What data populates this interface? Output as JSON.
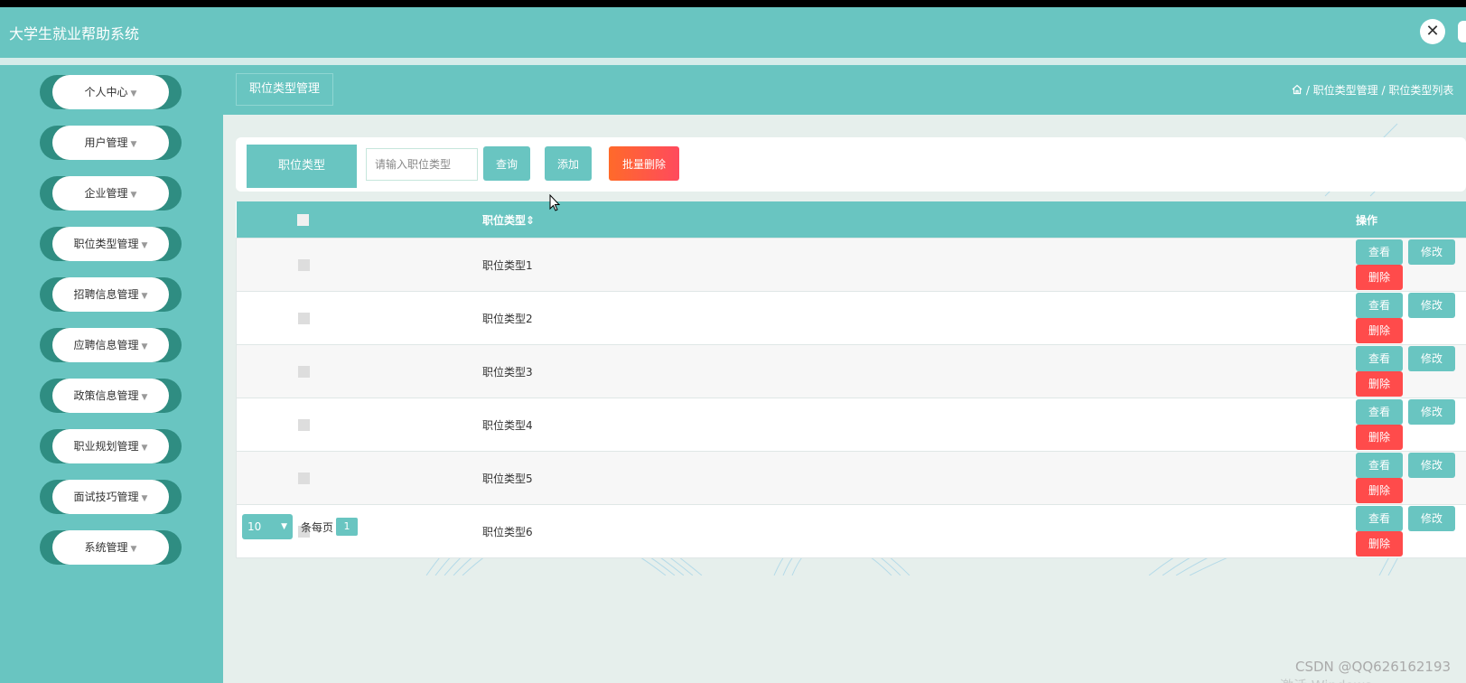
{
  "header": {
    "title": "大学生就业帮助系统"
  },
  "sidebar": {
    "items": [
      {
        "label": "个人中心"
      },
      {
        "label": "用户管理"
      },
      {
        "label": "企业管理"
      },
      {
        "label": "职位类型管理"
      },
      {
        "label": "招聘信息管理"
      },
      {
        "label": "应聘信息管理"
      },
      {
        "label": "政策信息管理"
      },
      {
        "label": "职业规划管理"
      },
      {
        "label": "面试技巧管理"
      },
      {
        "label": "系统管理"
      }
    ]
  },
  "breadcrumb": {
    "page_title": "职位类型管理",
    "path": "/ 职位类型管理 / 职位类型列表"
  },
  "search": {
    "label": "职位类型",
    "placeholder": "请输入职位类型",
    "query_label": "查询",
    "add_label": "添加",
    "batch_delete_label": "批量删除"
  },
  "table": {
    "columns": [
      "职位类型",
      "操作"
    ],
    "sort_indicator": "⇕",
    "rows": [
      {
        "name": "职位类型1"
      },
      {
        "name": "职位类型2"
      },
      {
        "name": "职位类型3"
      },
      {
        "name": "职位类型4"
      },
      {
        "name": "职位类型5"
      },
      {
        "name": "职位类型6"
      }
    ],
    "actions": {
      "view": "查看",
      "edit": "修改",
      "delete": "删除"
    }
  },
  "pagination": {
    "page_size": "10",
    "per_page_label": "条每页",
    "current_page": "1"
  },
  "watermark": "CSDN @QQ626162193",
  "os_watermark": "激活 Windows",
  "colors": {
    "primary": "#69c5c1",
    "danger": "#ff4b4b",
    "menu_edge": "#2f8d82"
  }
}
